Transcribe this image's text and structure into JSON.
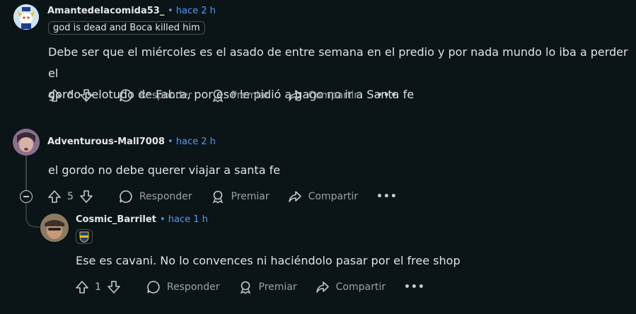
{
  "comments": [
    {
      "username": "Amantedelacomida53_",
      "time": "• hace 2 h",
      "flair": "god is dead and Boca killed him",
      "body_line1": "Debe ser que el miércoles es el asado de entre semana en el predio y por nada mundo lo iba a perder el",
      "body_line2": "gordo pelotudo de Fabra, por eso le pidió a gago no ir a Santa fe",
      "votes": "6",
      "avatar_icon": "snoo-avatar-icon"
    },
    {
      "username": "Adventurous-Mall7008",
      "time": "• hace 2 h",
      "body_line1": "el gordo no debe querer viajar a santa fe",
      "votes": "5",
      "avatar_icon": "user-photo-avatar"
    },
    {
      "username": "Cosmic_Barrilet",
      "time": "• hace 1 h",
      "flair_icon": "boca-crest-icon",
      "body_line1": "Ese es cavani. No lo convences ni haciéndolo pasar por el free shop",
      "votes": "1",
      "avatar_icon": "user-photo-avatar"
    }
  ],
  "actions": {
    "reply_label": "Responder",
    "award_label": "Premiar",
    "share_label": "Compartir",
    "more_label": "•••"
  },
  "colors": {
    "background": "#0b1416",
    "timestamp": "#4f9cf9",
    "muted": "#9aa3a9"
  }
}
